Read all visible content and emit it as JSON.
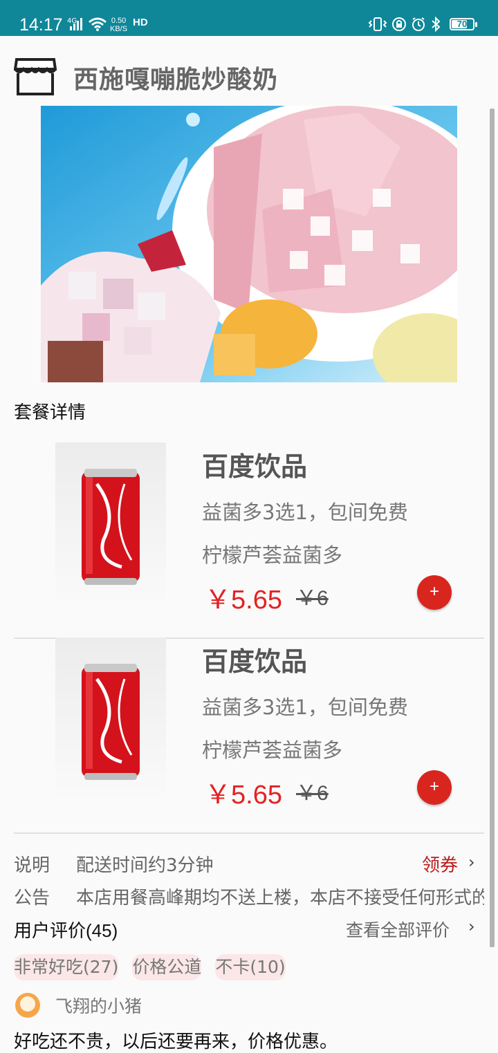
{
  "status_bar": {
    "time": "14:17",
    "network": "4G",
    "speed_value": "0.50",
    "speed_unit": "KB/S",
    "hd": "HD",
    "battery": "70"
  },
  "shop": {
    "name": "西施嘎嘣脆炒酸奶",
    "icon": "store-icon"
  },
  "section_title": "套餐详情",
  "products": [
    {
      "name": "百度饮品",
      "desc": "益菌多3选1，包间免费",
      "sub": "柠檬芦荟益菌多",
      "price": "￥5.65",
      "old_price": "￥6",
      "add_label": "+"
    },
    {
      "name": "百度饮品",
      "desc": "益菌多3选1，包间免费",
      "sub": "柠檬芦荟益菌多",
      "price": "￥5.65",
      "old_price": "￥6",
      "add_label": "+"
    }
  ],
  "info": {
    "note_label": "说明",
    "note_text": "配送时间约3分钟",
    "coupon": "领券",
    "announce_label": "公告",
    "announce_text": "本店用餐高峰期均不送上楼，本店不接受任何形式的预订"
  },
  "reviews": {
    "title": "用户评价(45)",
    "view_all": "查看全部评价",
    "tags": [
      "非常好吃(27)",
      "价格公道",
      "不卡(10)"
    ],
    "reviewer": "飞翔的小猪",
    "text": "好吃还不贵，以后还要再来，价格优惠。"
  },
  "colors": {
    "status_bar": "#0f8799",
    "price": "#e32222",
    "add_button": "#d8261f",
    "coupon": "#b81c1c",
    "tag_bg": "#fbe7e7"
  }
}
